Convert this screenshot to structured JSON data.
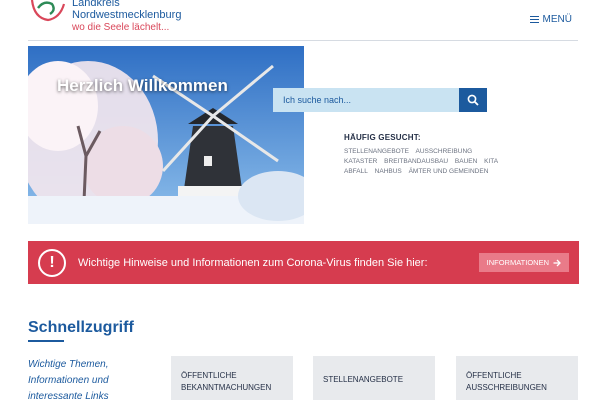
{
  "header": {
    "logo_line1": "Landkreis",
    "logo_line2": "Nordwestmecklenburg",
    "logo_tagline": "wo die Seele lächelt...",
    "menu_label": "MENÜ"
  },
  "hero": {
    "title": "Herzlich Willkommen"
  },
  "search": {
    "placeholder": "Ich suche nach..."
  },
  "often_searched": {
    "title": "HÄUFIG GESUCHT:",
    "links": [
      "STELLENANGEBOTE",
      "AUSSCHREIBUNG",
      "KATASTER",
      "BREITBANDAUSBAU",
      "BAUEN",
      "KITA",
      "ABFALL",
      "NAHBUS",
      "ÄMTER UND GEMEINDEN"
    ]
  },
  "corona": {
    "text": "Wichtige Hinweise und Informationen zum Corona-Virus finden Sie hier:",
    "button": "INFORMATIONEN",
    "icon": "!"
  },
  "quick_access": {
    "title": "Schnellzugriff",
    "description": "Wichtige Themen, Informationen und interessante Links",
    "tiles": [
      "ÖFFENTLICHE BEKANNTMACHUNGEN",
      "STELLENANGEBOTE",
      "ÖFFENTLICHE AUSSCHREIBUNGEN"
    ]
  },
  "colors": {
    "brand_blue": "#1c5a9e",
    "alert_red": "#d63c4f",
    "search_bg": "#c9e3f2"
  }
}
